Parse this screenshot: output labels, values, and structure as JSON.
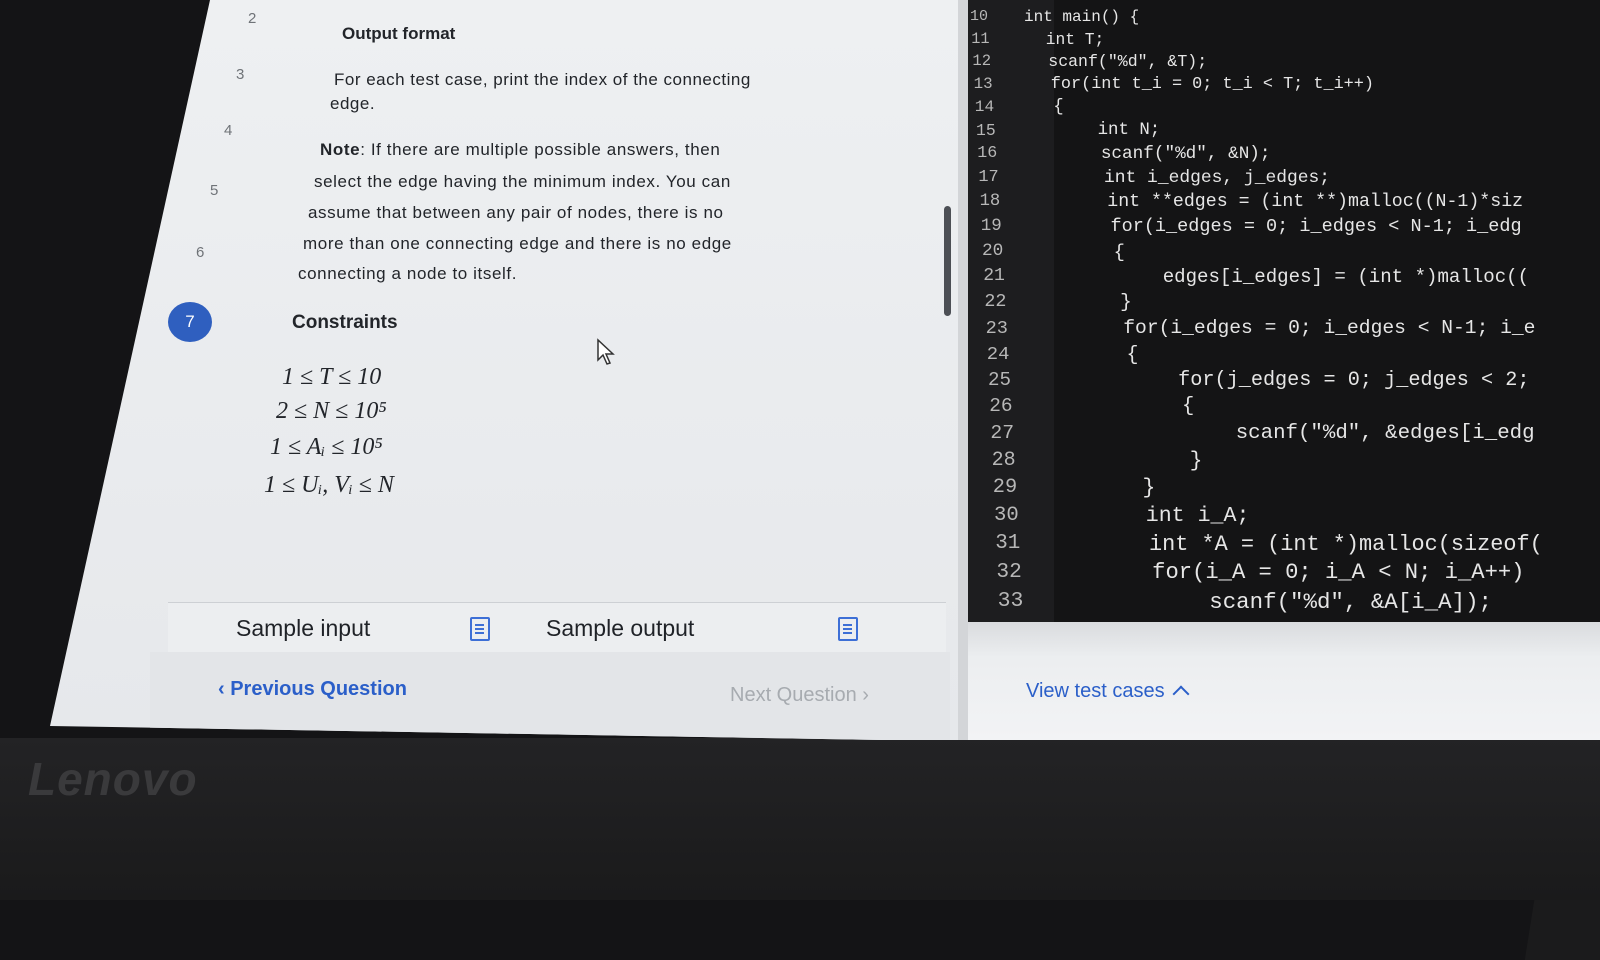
{
  "brand": {
    "logo": "Lenovo"
  },
  "problem": {
    "line_numbers": [
      "2",
      "3",
      "4",
      "5",
      "6"
    ],
    "active_step": "7",
    "output_format_title": "Output format",
    "output_format_line1": "For each test case, print the index of the connecting",
    "output_format_line2": "edge.",
    "note_label": "Note",
    "note_lines": [
      ": If there are multiple possible answers, then",
      "select the edge having the minimum index. You can",
      "assume that between any pair of nodes, there is no",
      "more than one connecting edge and there is no edge",
      "connecting a node to itself."
    ],
    "constraints_title": "Constraints",
    "constraints": [
      "1 ≤ T ≤ 10",
      "2 ≤ N ≤ 10⁵",
      "1 ≤ Aᵢ ≤ 10⁵",
      "1 ≤ Uᵢ, Vᵢ ≤ N"
    ],
    "sample_input_label": "Sample input",
    "sample_output_label": "Sample output",
    "prev_question": "Previous Question",
    "next_question": "Next Question"
  },
  "editor": {
    "line_numbers": [
      "10",
      "11",
      "12",
      "13",
      "14",
      "15",
      "16",
      "17",
      "18",
      "19",
      "20",
      "21",
      "22",
      "23",
      "24",
      "25",
      "26",
      "27",
      "28",
      "29",
      "30",
      "31",
      "32",
      "33"
    ],
    "lines": [
      "int main() {",
      "  int T;",
      "  scanf(\"%d\", &T);",
      "  for(int t_i = 0; t_i < T; t_i++)",
      "  {",
      "      int N;",
      "      scanf(\"%d\", &N);",
      "      int i_edges, j_edges;",
      "      int **edges = (int **)malloc((N-1)*siz",
      "      for(i_edges = 0; i_edges < N-1; i_edg",
      "      {",
      "          edges[i_edges] = (int *)malloc((",
      "      }",
      "      for(i_edges = 0; i_edges < N-1; i_e",
      "      {",
      "          for(j_edges = 0; j_edges < 2;",
      "          {",
      "              scanf(\"%d\", &edges[i_edg",
      "          }",
      "      }",
      "      int i_A;",
      "      int *A = (int *)malloc(sizeof(",
      "      for(i_A = 0; i_A < N; i_A++)",
      "          scanf(\"%d\", &A[i_A]);"
    ],
    "view_test_cases": "View test cases"
  }
}
